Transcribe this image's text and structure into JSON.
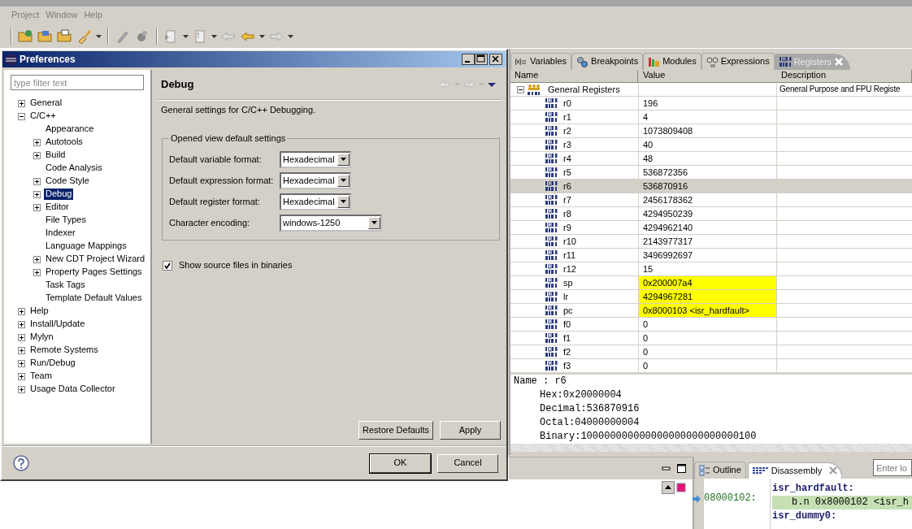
{
  "menu": [
    "Project",
    "Window",
    "Help"
  ],
  "dialog": {
    "title": "Preferences",
    "filter": {
      "placeholder": "type filter text"
    },
    "tree": [
      {
        "label": "General",
        "expanded": false,
        "selected": false
      },
      {
        "label": "C/C++",
        "expanded": true,
        "selected": false,
        "children": [
          {
            "label": "Appearance",
            "selected": false
          },
          {
            "label": "Autotools",
            "expanded": false,
            "selected": false
          },
          {
            "label": "Build",
            "expanded": false,
            "selected": false
          },
          {
            "label": "Code Analysis",
            "selected": false
          },
          {
            "label": "Code Style",
            "expanded": false,
            "selected": false
          },
          {
            "label": "Debug",
            "expanded": false,
            "selected": true
          },
          {
            "label": "Editor",
            "expanded": false,
            "selected": false
          },
          {
            "label": "File Types",
            "selected": false
          },
          {
            "label": "Indexer",
            "selected": false
          },
          {
            "label": "Language Mappings",
            "selected": false
          },
          {
            "label": "New CDT Project Wizard",
            "expanded": false,
            "selected": false
          },
          {
            "label": "Property Pages Settings",
            "expanded": false,
            "selected": false
          },
          {
            "label": "Task Tags",
            "selected": false
          },
          {
            "label": "Template Default Values",
            "selected": false
          }
        ]
      },
      {
        "label": "Help",
        "expanded": false,
        "selected": false
      },
      {
        "label": "Install/Update",
        "expanded": false,
        "selected": false
      },
      {
        "label": "Mylyn",
        "expanded": false,
        "selected": false
      },
      {
        "label": "Remote Systems",
        "expanded": false,
        "selected": false
      },
      {
        "label": "Run/Debug",
        "expanded": false,
        "selected": false
      },
      {
        "label": "Team",
        "expanded": false,
        "selected": false
      },
      {
        "label": "Usage Data Collector",
        "expanded": false,
        "selected": false
      }
    ],
    "page": {
      "title": "Debug",
      "description": "General settings for C/C++ Debugging.",
      "group": {
        "title": "Opened view default settings",
        "fields": [
          {
            "label": "Default variable format:",
            "value": "Hexadecimal",
            "kind": "short"
          },
          {
            "label": "Default expression format:",
            "value": "Hexadecimal",
            "kind": "short"
          },
          {
            "label": "Default register format:",
            "value": "Hexadecimal",
            "kind": "short"
          },
          {
            "label": "Character encoding:",
            "value": "windows-1250",
            "kind": "wide"
          }
        ]
      },
      "checkbox": {
        "label": "Show source files in binaries",
        "checked": true
      },
      "buttons": [
        "Restore Defaults",
        "Apply"
      ]
    },
    "buttons": [
      {
        "label": "OK",
        "default": true
      },
      {
        "label": "Cancel",
        "default": false
      }
    ]
  },
  "registers": {
    "tabs": [
      {
        "label": "Variables",
        "selected": false
      },
      {
        "label": "Breakpoints",
        "selected": false
      },
      {
        "label": "Modules",
        "selected": false
      },
      {
        "label": "Expressions",
        "selected": false
      },
      {
        "label": "Registers",
        "selected": true
      }
    ],
    "columns": [
      "Name",
      "Value",
      "Description"
    ],
    "group": {
      "name": "General Registers",
      "description": "General Purpose and FPU Registe",
      "expanded": true,
      "selected": false
    },
    "rows": [
      {
        "name": "r0",
        "value": "196",
        "changed": false,
        "selected": false
      },
      {
        "name": "r1",
        "value": "4",
        "changed": false,
        "selected": false
      },
      {
        "name": "r2",
        "value": "1073809408",
        "changed": false,
        "selected": false
      },
      {
        "name": "r3",
        "value": "40",
        "changed": false,
        "selected": false
      },
      {
        "name": "r4",
        "value": "48",
        "changed": false,
        "selected": false
      },
      {
        "name": "r5",
        "value": "536872356",
        "changed": false,
        "selected": false
      },
      {
        "name": "r6",
        "value": "536870916",
        "changed": false,
        "selected": true
      },
      {
        "name": "r7",
        "value": "2456178362",
        "changed": false,
        "selected": false
      },
      {
        "name": "r8",
        "value": "4294950239",
        "changed": false,
        "selected": false
      },
      {
        "name": "r9",
        "value": "4294962140",
        "changed": false,
        "selected": false
      },
      {
        "name": "r10",
        "value": "2143977317",
        "changed": false,
        "selected": false
      },
      {
        "name": "r11",
        "value": "3496992697",
        "changed": false,
        "selected": false
      },
      {
        "name": "r12",
        "value": "15",
        "changed": false,
        "selected": false
      },
      {
        "name": "sp",
        "value": "0x200007a4",
        "changed": true,
        "selected": false
      },
      {
        "name": "lr",
        "value": "4294967281",
        "changed": true,
        "selected": false
      },
      {
        "name": "pc",
        "value": "0x8000103 <isr_hardfault>",
        "changed": true,
        "selected": false
      },
      {
        "name": "f0",
        "value": "0",
        "changed": false,
        "selected": false
      },
      {
        "name": "f1",
        "value": "0",
        "changed": false,
        "selected": false
      },
      {
        "name": "f2",
        "value": "0",
        "changed": false,
        "selected": false
      },
      {
        "name": "f3",
        "value": "0",
        "changed": false,
        "selected": false
      }
    ],
    "details": {
      "title": "Name : r6",
      "lines": [
        "Hex:0x20000004",
        "Decimal:536870916",
        "Octal:04000000004",
        "Binary:100000000000000000000000000100"
      ]
    }
  },
  "disassembly_view": {
    "tabs": [
      {
        "label": "Outline",
        "selected": false
      },
      {
        "label": "Disassembly",
        "selected": true
      }
    ],
    "address_field": {
      "placeholder": "Enter lo"
    },
    "lines": [
      {
        "kind": "label",
        "text": "isr_hardfault:"
      },
      {
        "kind": "instruction",
        "address": "08000102:",
        "text": "b.n 0x8000102 <isr_h",
        "current": true
      },
      {
        "kind": "label",
        "text": "isr_dummy0:"
      }
    ]
  }
}
